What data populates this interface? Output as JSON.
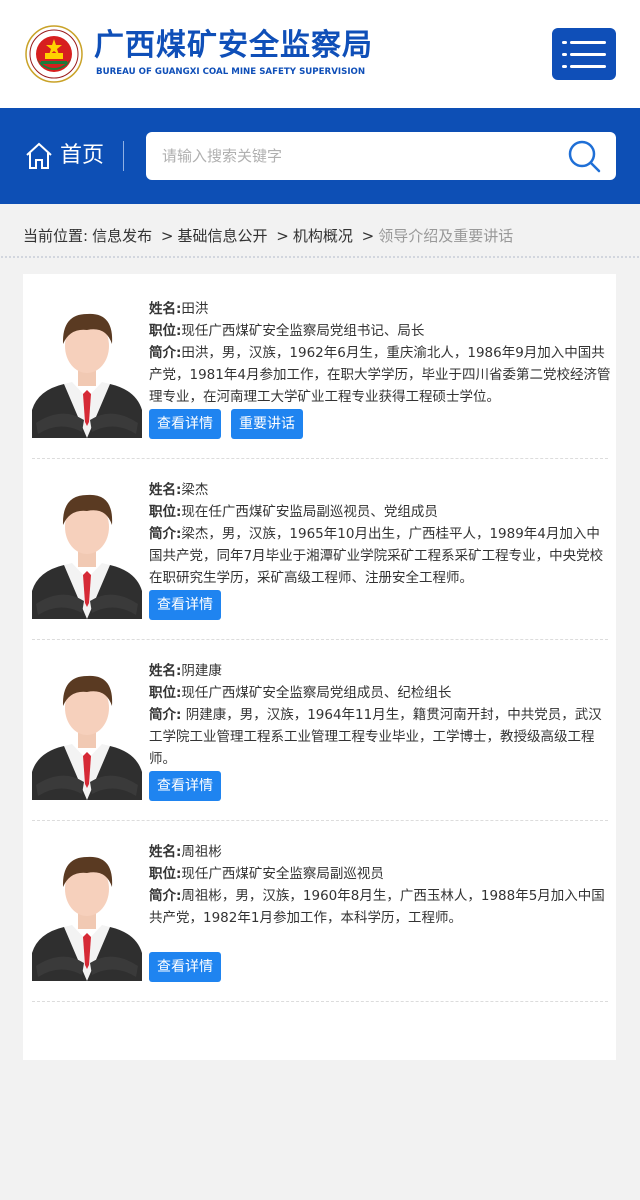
{
  "header": {
    "title_cn": "广西煤矿安全监察局",
    "title_en": "BUREAU OF GUANGXI COAL MINE SAFETY SUPERVISION",
    "brand_color": "#0f4fb8",
    "emblem_icon": "national-emblem",
    "menu_icon": "menu-icon"
  },
  "nav": {
    "home_label": "首页",
    "home_icon": "home-icon",
    "search_placeholder": "请输入搜索关键字",
    "search_icon": "search-icon",
    "bar_color": "#0d4fb5"
  },
  "breadcrumb": {
    "prefix": "当前位置:",
    "items": [
      "信息发布",
      "基础信息公开",
      "机构概况"
    ],
    "separator": ">",
    "current": "领导介绍及重要讲话"
  },
  "leaders": [
    {
      "name_key": "姓名:",
      "name": "田洪",
      "position_key": "职位:",
      "position": "现任广西煤矿安全监察局党组书记、局长",
      "bio_key": "简介:",
      "bio": "田洪，男，汉族，1962年6月生，重庆渝北人，1986年9月加入中国共产党，1981年4月参加工作，在职大学学历，毕业于四川省委第二党校经济管理专业，在河南理工大学矿业工程专业获得工程硕士学位。",
      "buttons": [
        "查看详情",
        "重要讲话"
      ]
    },
    {
      "name_key": "姓名:",
      "name": "梁杰",
      "position_key": "职位:",
      "position": "现在任广西煤矿安监局副巡视员、党组成员",
      "bio_key": "简介:",
      "bio": "梁杰，男，汉族，1965年10月出生，广西桂平人，1989年4月加入中国共产党，同年7月毕业于湘潭矿业学院采矿工程系采矿工程专业，中央党校在职研究生学历，采矿高级工程师、注册安全工程师。",
      "buttons": [
        "查看详情"
      ]
    },
    {
      "name_key": "姓名:",
      "name": "阴建康",
      "position_key": "职位:",
      "position": "现任广西煤矿安全监察局党组成员、纪检组长",
      "bio_key": "简介:",
      "bio": " 阴建康，男，汉族，1964年11月生，籍贯河南开封，中共党员，武汉工学院工业管理工程系工业管理工程专业毕业，工学博士，教授级高级工程师。",
      "buttons": [
        "查看详情"
      ]
    },
    {
      "name_key": "姓名:",
      "name": "周祖彬",
      "position_key": "职位:",
      "position": "现任广西煤矿安全监察局副巡视员",
      "bio_key": "简介:",
      "bio": "周祖彬，男，汉族，1960年8月生，广西玉林人，1988年5月加入中国共产党，1982年1月参加工作，本科学历，工程师。",
      "buttons": [
        "查看详情"
      ]
    }
  ],
  "colors": {
    "button": "#1f84f0",
    "page_bg": "#f2f2f2"
  }
}
